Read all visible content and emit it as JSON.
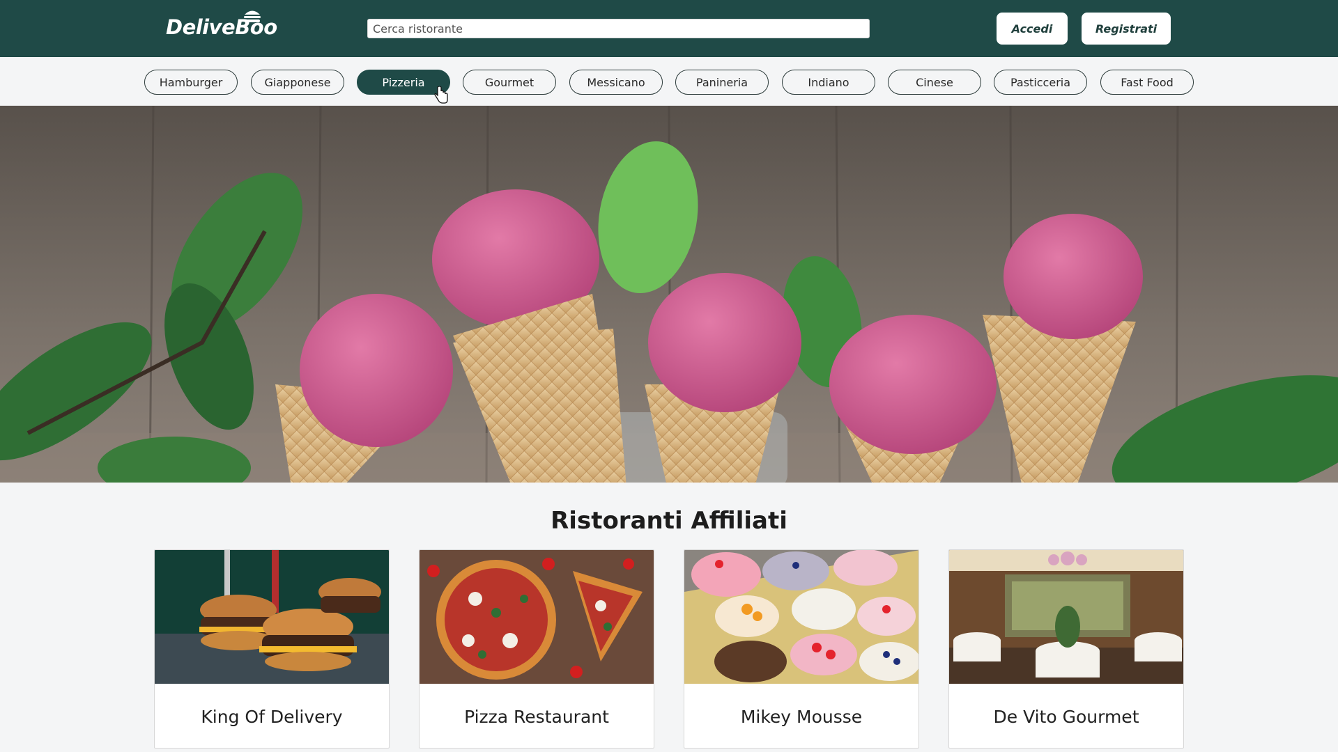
{
  "header": {
    "logo_text": "DeliveBoo",
    "search": {
      "placeholder": "Cerca ristorante",
      "value": ""
    },
    "login_label": "Accedi",
    "register_label": "Registrati"
  },
  "categories": {
    "selected": "Pizzeria",
    "items": [
      "Hamburger",
      "Giapponese",
      "Pizzeria",
      "Gourmet",
      "Messicano",
      "Panineria",
      "Indiano",
      "Cinese",
      "Pasticceria",
      "Fast Food"
    ]
  },
  "hero": {
    "image": "ice-cream-cones-banner"
  },
  "restaurants": {
    "title": "Ristoranti Affiliati",
    "items": [
      {
        "name": "King Of Delivery",
        "image": "burger-photo"
      },
      {
        "name": "Pizza Restaurant",
        "image": "pizza-photo"
      },
      {
        "name": "Mikey Mousse",
        "image": "desserts-photo"
      },
      {
        "name": "De Vito Gourmet",
        "image": "dining-room-photo"
      }
    ]
  },
  "colors": {
    "header_bg": "#1f4a47",
    "accent": "#1f4a47",
    "page_bg": "#f4f5f6"
  }
}
